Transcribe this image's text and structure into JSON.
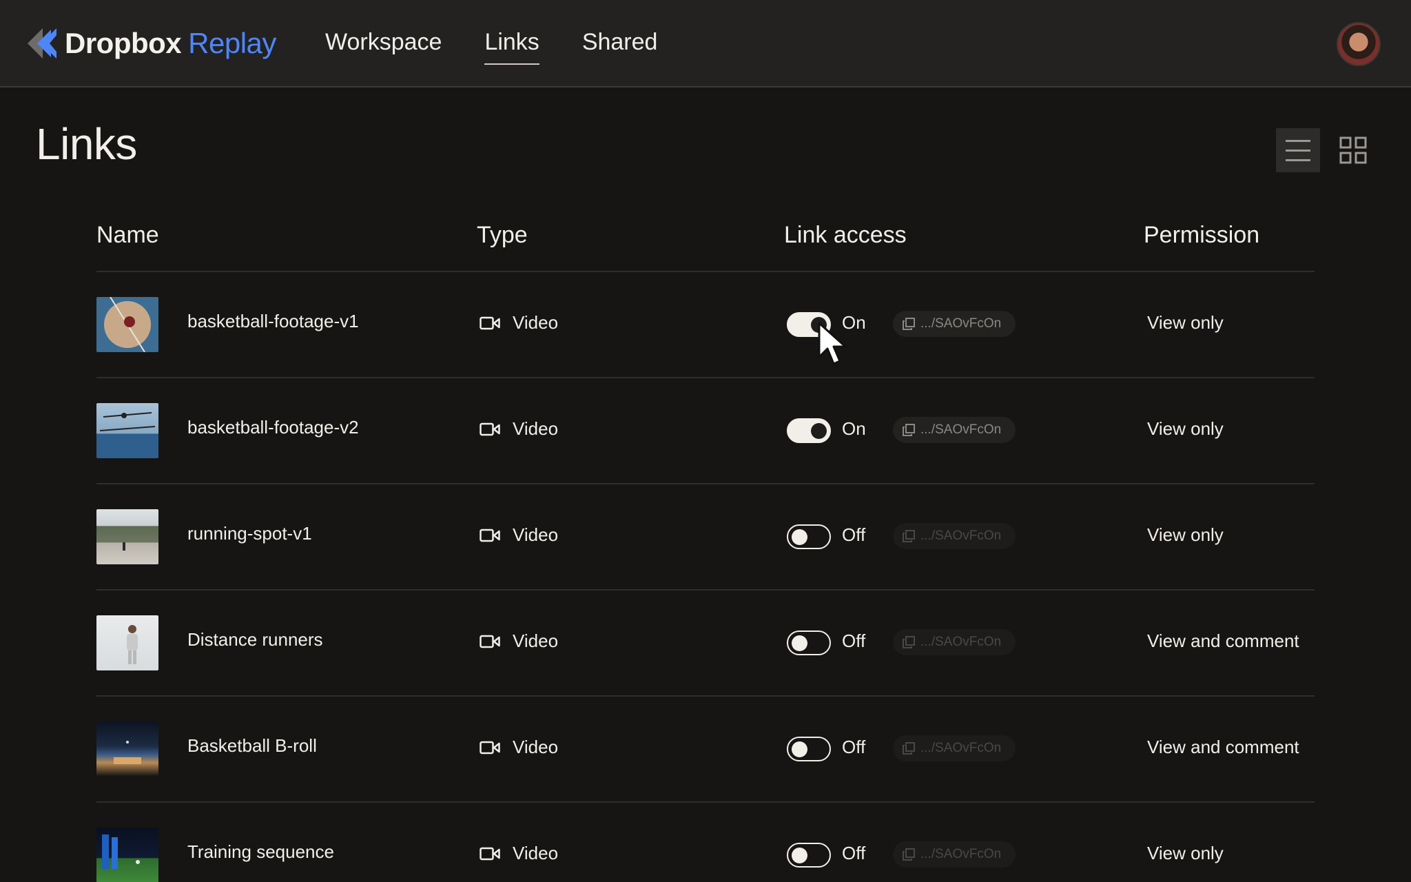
{
  "header": {
    "brand_primary": "Dropbox",
    "brand_secondary": "Replay",
    "nav": [
      {
        "label": "Workspace",
        "active": false
      },
      {
        "label": "Links",
        "active": true
      },
      {
        "label": "Shared",
        "active": false
      }
    ]
  },
  "page": {
    "title": "Links",
    "view_modes": [
      "list-icon",
      "grid-icon"
    ],
    "active_view": "list"
  },
  "table": {
    "columns": [
      "Name",
      "Type",
      "Link access",
      "Permission"
    ],
    "rows": [
      {
        "name": "basketball-footage-v1",
        "type": "Video",
        "access": "On",
        "link": ".../SAOvFcOn",
        "permission": "View only"
      },
      {
        "name": "basketball-footage-v2",
        "type": "Video",
        "access": "On",
        "link": ".../SAOvFcOn",
        "permission": "View only"
      },
      {
        "name": "running-spot-v1",
        "type": "Video",
        "access": "Off",
        "link": ".../SAOvFcOn",
        "permission": "View only"
      },
      {
        "name": "Distance runners",
        "type": "Video",
        "access": "Off",
        "link": ".../SAOvFcOn",
        "permission": "View and comment"
      },
      {
        "name": "Basketball B-roll",
        "type": "Video",
        "access": "Off",
        "link": ".../SAOvFcOn",
        "permission": "View and comment"
      },
      {
        "name": "Training sequence",
        "type": "Video",
        "access": "Off",
        "link": ".../SAOvFcOn",
        "permission": "View only"
      }
    ]
  },
  "colors": {
    "background": "#161514",
    "header": "#232221",
    "accent_blue": "#4f86f7",
    "text": "#f2efe9"
  }
}
